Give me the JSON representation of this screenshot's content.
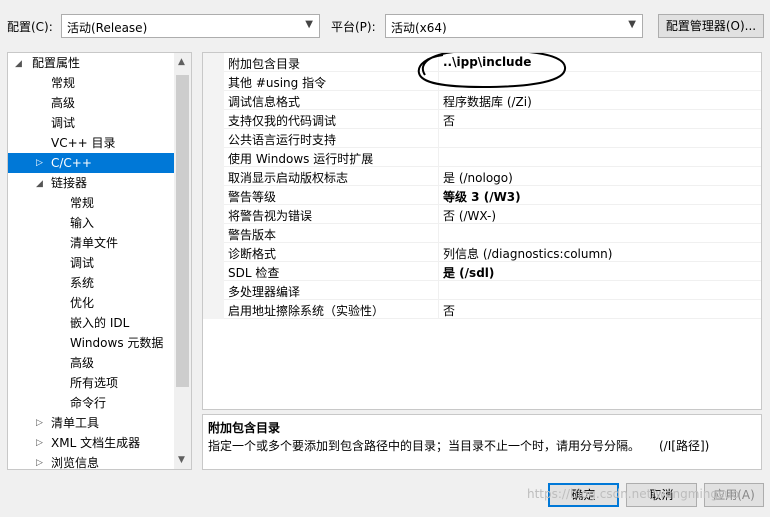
{
  "toolbar": {
    "config_label": "配置(C):",
    "config_value": "活动(Release)",
    "platform_label": "平台(P):",
    "platform_value": "活动(x64)",
    "config_manager_label": "配置管理器(O)..."
  },
  "tree": {
    "root": "配置属性",
    "items": [
      {
        "label": "常规"
      },
      {
        "label": "高级"
      },
      {
        "label": "调试"
      },
      {
        "label": "VC++ 目录"
      },
      {
        "label": "C/C++"
      },
      {
        "label": "链接器"
      },
      {
        "label": "常规"
      },
      {
        "label": "输入"
      },
      {
        "label": "清单文件"
      },
      {
        "label": "调试"
      },
      {
        "label": "系统"
      },
      {
        "label": "优化"
      },
      {
        "label": "嵌入的 IDL"
      },
      {
        "label": "Windows 元数据"
      },
      {
        "label": "高级"
      },
      {
        "label": "所有选项"
      },
      {
        "label": "命令行"
      },
      {
        "label": "清单工具"
      },
      {
        "label": "XML 文档生成器"
      },
      {
        "label": "浏览信息"
      }
    ]
  },
  "properties": [
    {
      "name": "附加包含目录",
      "value": "..\\ipp\\include"
    },
    {
      "name": "其他 #using 指令",
      "value": ""
    },
    {
      "name": "调试信息格式",
      "value": "程序数据库 (/Zi)"
    },
    {
      "name": "支持仅我的代码调试",
      "value": "否"
    },
    {
      "name": "公共语言运行时支持",
      "value": ""
    },
    {
      "name": "使用 Windows 运行时扩展",
      "value": ""
    },
    {
      "name": "取消显示启动版权标志",
      "value": "是 (/nologo)"
    },
    {
      "name": "警告等级",
      "value": "等级 3 (/W3)"
    },
    {
      "name": "将警告视为错误",
      "value": "否 (/WX-)"
    },
    {
      "name": "警告版本",
      "value": ""
    },
    {
      "name": "诊断格式",
      "value": "列信息 (/diagnostics:column)"
    },
    {
      "name": "SDL 检查",
      "value": "是 (/sdl)"
    },
    {
      "name": "多处理器编译",
      "value": ""
    },
    {
      "name": "启用地址擦除系统（实验性）",
      "value": "否"
    }
  ],
  "description": {
    "title": "附加包含目录",
    "text": "指定一个或多个要添加到包含路径中的目录；当目录不止一个时，请用分号分隔。",
    "option": "(/I[路径])"
  },
  "buttons": {
    "ok": "确定",
    "cancel": "取消",
    "apply": "应用(A)"
  },
  "watermark": "https://blog.csdn.net/wangmingsuo"
}
